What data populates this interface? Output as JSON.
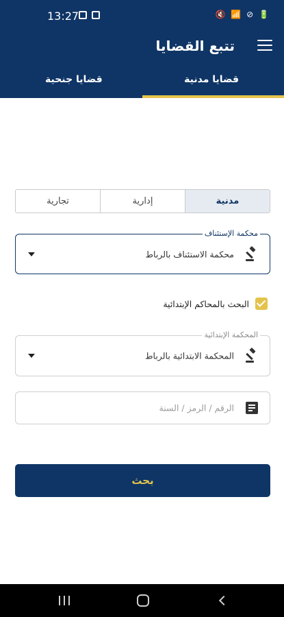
{
  "status_bar": {
    "time": "13:27",
    "right_icons": "🔇 📶 ⊘ 🔋"
  },
  "app_bar": {
    "title": "تتبع القضايا"
  },
  "tabs": [
    {
      "label": "قضايا مدنية",
      "selected": true
    },
    {
      "label": "قضايا جنحية",
      "selected": false
    }
  ],
  "case_types": [
    {
      "label": "مدنية",
      "selected": true
    },
    {
      "label": "إدارية",
      "selected": false
    },
    {
      "label": "تجارية",
      "selected": false
    }
  ],
  "appeal_court": {
    "label": "محكمة الإستئناف",
    "value": "محكمة الاستئناف بالرباط"
  },
  "first_instance_checkbox": {
    "label": "البحث بالمحاكم الإبتدائية",
    "checked": true
  },
  "first_instance_court": {
    "label": "المحكمة الإبتدائية",
    "value": "المحكمة الابتدائية بالرباط"
  },
  "case_number": {
    "placeholder": "الرقم / الرمز / السنة"
  },
  "search_button": {
    "label": "بحث"
  },
  "colors": {
    "primary": "#0f3566",
    "accent": "#e5c34b"
  }
}
